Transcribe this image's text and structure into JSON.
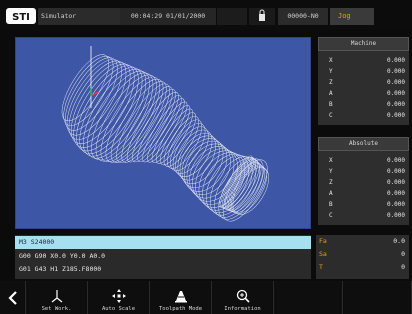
{
  "header": {
    "app_title": "Simulator",
    "datetime": "00:04:29 01/01/2000",
    "program_id": "00000-N0",
    "mode": "Jog",
    "lock_icon": "lock-icon",
    "logo_icon": "sti-logo"
  },
  "machine": {
    "title": "Machine",
    "axes": [
      {
        "axis": "X",
        "value": "0.000"
      },
      {
        "axis": "Y",
        "value": "0.000"
      },
      {
        "axis": "Z",
        "value": "0.000"
      },
      {
        "axis": "A",
        "value": "0.000"
      },
      {
        "axis": "B",
        "value": "0.000"
      },
      {
        "axis": "C",
        "value": "0.000"
      }
    ]
  },
  "absolute": {
    "title": "Absolute",
    "axes": [
      {
        "axis": "X",
        "value": "0.000"
      },
      {
        "axis": "Y",
        "value": "0.000"
      },
      {
        "axis": "Z",
        "value": "0.000"
      },
      {
        "axis": "A",
        "value": "0.000"
      },
      {
        "axis": "B",
        "value": "0.000"
      },
      {
        "axis": "C",
        "value": "0.000"
      }
    ]
  },
  "program": {
    "lines": [
      "M3 S24000",
      "G00 G90 X0.0 Y0.0 A0.0",
      "G01 G43 H1 Z185.F8000"
    ]
  },
  "feed": {
    "rows": [
      {
        "label": "Fa",
        "value": "0.0"
      },
      {
        "label": "Sa",
        "value": "0"
      },
      {
        "label": "T",
        "value": "0"
      }
    ]
  },
  "toolbar": {
    "back_icon": "chevron-left-icon",
    "buttons": [
      {
        "label": "Set Work.",
        "icon": "work-offset-icon"
      },
      {
        "label": "Auto Scale",
        "icon": "auto-scale-icon"
      },
      {
        "label": "Toolpath Mode",
        "icon": "toolpath-mode-icon"
      },
      {
        "label": "Information",
        "icon": "magnifier-icon"
      }
    ]
  },
  "colors": {
    "viewport_bg": "#3e56a6",
    "toolpath": "#ffffff",
    "mode_text": "#e0a020",
    "active_line": "#a6dff0"
  }
}
